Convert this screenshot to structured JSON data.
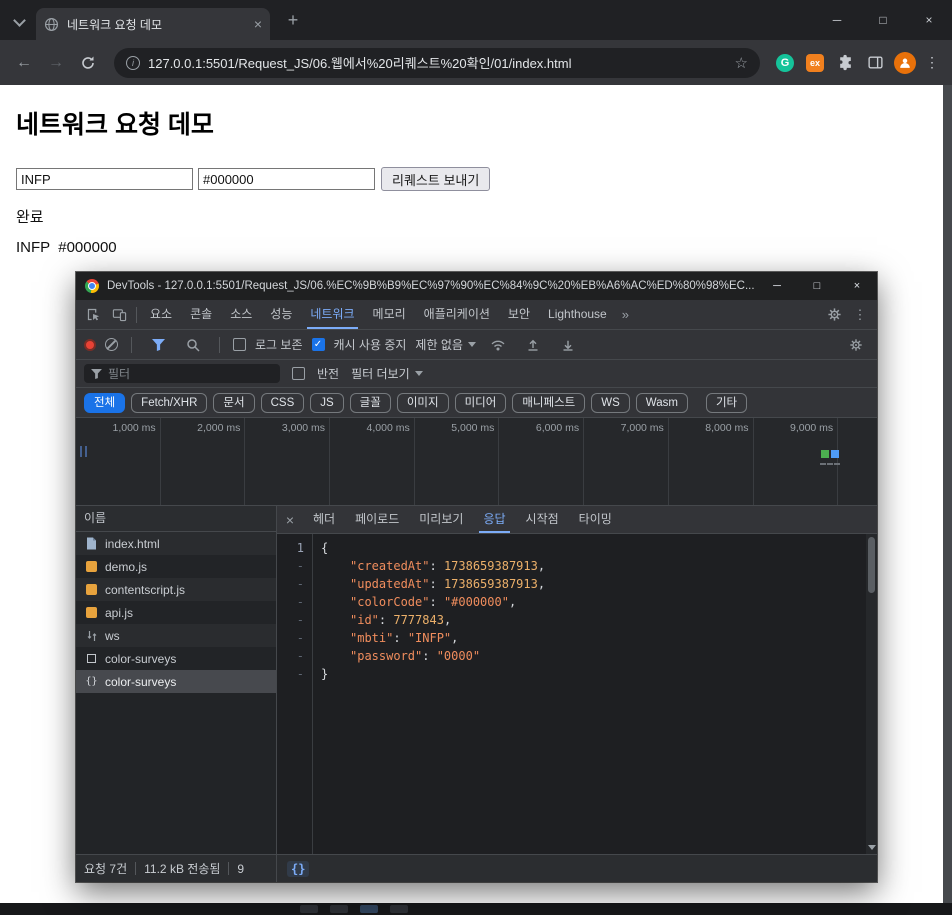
{
  "browser": {
    "tab_title": "네트워크 요청 데모",
    "url": "127.0.0.1:5501/Request_JS/06.웹에서%20리퀘스트%20확인/01/index.html",
    "window_controls": {
      "minimize": "─",
      "maximize": "□",
      "close": "×"
    },
    "tab_close": "×",
    "new_tab": "+",
    "back": "←",
    "forward": "→",
    "info": "i",
    "star": "☆",
    "grammarly": "G",
    "ex_badge": "ex",
    "kebab": "⋮"
  },
  "page": {
    "heading": "네트워크 요청 데모",
    "mbti_value": "INFP",
    "color_value": "#000000",
    "send_button": "리퀘스트 보내기",
    "status_text": "완료",
    "result_text": "INFP  #000000"
  },
  "devtools": {
    "window_title": "DevTools - 127.0.0.1:5501/Request_JS/06.%EC%9B%B9%EC%97%90%EC%84%9C%20%EB%A6%AC%ED%80%98%EC...",
    "window_controls": {
      "minimize": "─",
      "maximize": "□",
      "close": "×"
    },
    "tabs": [
      "요소",
      "콘솔",
      "소스",
      "성능",
      "네트워크",
      "메모리",
      "애플리케이션",
      "보안",
      "Lighthouse"
    ],
    "more_tabs": "»",
    "toolbar": {
      "preserve_log": "로그 보존",
      "disable_cache": "캐시 사용 중지",
      "throttling": "제한 없음",
      "check": "✓"
    },
    "filter_bar": {
      "placeholder": "필터",
      "invert": "반전",
      "more_filters": "필터 더보기"
    },
    "chips": [
      "전체",
      "Fetch/XHR",
      "문서",
      "CSS",
      "JS",
      "글꼴",
      "이미지",
      "미디어",
      "매니페스트",
      "WS",
      "Wasm",
      "기타"
    ],
    "timeline_ticks": [
      "1,000 ms",
      "2,000 ms",
      "3,000 ms",
      "4,000 ms",
      "5,000 ms",
      "6,000 ms",
      "7,000 ms",
      "8,000 ms",
      "9,000 ms"
    ],
    "name_header": "이름",
    "requests": [
      {
        "label": "index.html"
      },
      {
        "label": "demo.js"
      },
      {
        "label": "contentscript.js"
      },
      {
        "label": "api.js"
      },
      {
        "label": "ws"
      },
      {
        "label": "color-surveys"
      },
      {
        "label": "color-surveys"
      }
    ],
    "detail_tabs": [
      "헤더",
      "페이로드",
      "미리보기",
      "응답",
      "시작점",
      "타이밍"
    ],
    "detail_close": "×",
    "icons": {
      "braces": "{}"
    },
    "response": {
      "gutter": [
        "1",
        "-",
        "-",
        "-",
        "-",
        "-",
        "-",
        "-"
      ],
      "open_brace": "{",
      "close_brace": "}",
      "entries": [
        {
          "key": "\"createdAt\"",
          "colon": ": ",
          "value": "1738659387913",
          "comma": ","
        },
        {
          "key": "\"updatedAt\"",
          "colon": ": ",
          "value": "1738659387913",
          "comma": ","
        },
        {
          "key": "\"colorCode\"",
          "colon": ": ",
          "value": "\"#000000\"",
          "comma": ","
        },
        {
          "key": "\"id\"",
          "colon": ": ",
          "value": "7777843",
          "comma": ","
        },
        {
          "key": "\"mbti\"",
          "colon": ": ",
          "value": "\"INFP\"",
          "comma": ","
        },
        {
          "key": "\"password\"",
          "colon": ": ",
          "value": "\"0000\"",
          "comma": ""
        }
      ]
    },
    "summary": [
      "요청 7건",
      "11.2 kB 전송됨",
      "9"
    ]
  }
}
